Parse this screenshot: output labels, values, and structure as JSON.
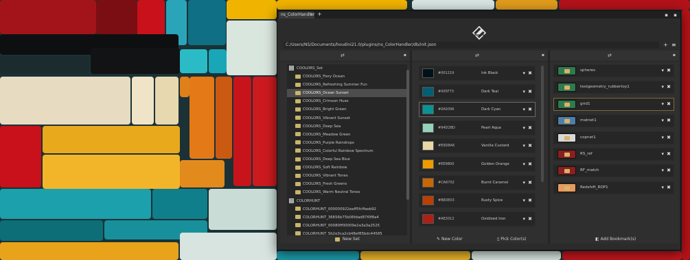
{
  "window": {
    "tab_title": "ns_ColorHandler",
    "tab_close": "×",
    "add_tab": "+",
    "window_controls": "▪ ▪"
  },
  "path": {
    "value": "C:/Users/NS/Documents/houdini21.0/plugins/ns_ColorHandler/db/init.json",
    "add": "+",
    "menu": "≡"
  },
  "panel_icons": {
    "swap": "⇄",
    "menu": "▪"
  },
  "sets": {
    "groups": [
      {
        "name": "COOLORS_Set",
        "items": [
          "COOLORS_Fiery Ocean",
          "COOLORS_Refreshing Summer Fun",
          "COOLORS_Ocean Sunset",
          "COOLORS_Crimson Hues",
          "COOLORS_Bright Green",
          "COOLORS_Vibrant Sunset",
          "COOLORS_Deep Sea",
          "COOLORS_Meadow Green",
          "COOLORS_Purple Raindrops",
          "COOLORS_Colorful Rainbow Spectrum",
          "COOLORS_Deep Sea Blue",
          "COOLORS_Soft Rainbow",
          "COOLORS_Vibrant Tones",
          "COOLORS_Fresh Greens",
          "COOLORS_Warm Neutral Tones"
        ]
      },
      {
        "name": "COLORHUNT",
        "items": [
          "COLORHUNT_000000922eaff5fcffaeb92",
          "COLORHUNT_36656b75b06fdad87f0f8a4",
          "COLORHUNT_00080ff00009e2a3a3a2525",
          "COLORHUNT_5b2e3ca2cb48ef85bdc44585"
        ]
      }
    ],
    "selected": "COOLORS_Ocean Sunset",
    "new_set_label": "New Set"
  },
  "colors": {
    "items": [
      {
        "hex": "#001219",
        "name": "Ink Black",
        "swatch": "#001219"
      },
      {
        "hex": "#005F73",
        "name": "Dark Teal",
        "swatch": "#005F73"
      },
      {
        "hex": "#0A9396",
        "name": "Dark Cyan",
        "swatch": "#0A9396"
      },
      {
        "hex": "#94D2BD",
        "name": "Pearl Aqua",
        "swatch": "#94D2BD"
      },
      {
        "hex": "#E9D8A6",
        "name": "Vanilla Custard",
        "swatch": "#E9D8A6"
      },
      {
        "hex": "#EE9B00",
        "name": "Golden Orange",
        "swatch": "#EE9B00"
      },
      {
        "hex": "#CA6702",
        "name": "Burnt Caramel",
        "swatch": "#CA6702"
      },
      {
        "hex": "#BB3E03",
        "name": "Rusty Spice",
        "swatch": "#BB3E03"
      },
      {
        "hex": "#AE2012",
        "name": "Oxidized Iron",
        "swatch": "#AE2012"
      }
    ],
    "dropdown": "▾",
    "remove": "✖",
    "new_color_label": "New Color",
    "pick_color_label": "Pick Color(s)"
  },
  "bookmarks": {
    "items": [
      {
        "label": "spheres",
        "chip": "#2f7a4f"
      },
      {
        "label": "testgeometry_rubbertoy1",
        "chip": "#2f7a4f"
      },
      {
        "label": "grid1",
        "chip": "#2f7a4f"
      },
      {
        "label": "matnet1",
        "chip": "#4f7fa8"
      },
      {
        "label": "copnet1",
        "chip": "#d8d8d8"
      },
      {
        "label": "RS_ref",
        "chip": "#8a1f1f"
      },
      {
        "label": "RF_match",
        "chip": "#8a1f1f"
      },
      {
        "label": "Redshift_ROP1",
        "chip": "#e59a5f"
      }
    ],
    "add_bookmark_label": "Add Bookmark(s)"
  }
}
